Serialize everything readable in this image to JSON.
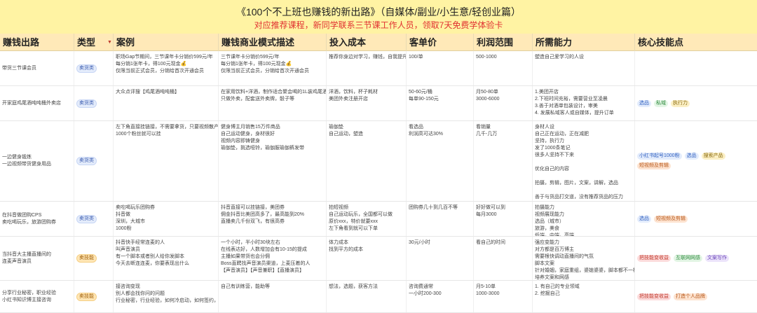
{
  "banner": {
    "title": "《100个不上班也赚钱的新出路》（自媒体/副业/小生意/轻创业篇）",
    "subtitle": "对应推荐课程，新同学联系三节课工作人员，领取7天免费学体验卡"
  },
  "columns": [
    "赚钱出路",
    "类型",
    "案例",
    "赚钱商业模式描述",
    "投入成本",
    "客单价",
    "利润范围",
    "所需能力",
    "核心技能点"
  ],
  "rows": [
    {
      "path": [
        "带货三节课会员"
      ],
      "type": "卖货类",
      "type_kind": "sell",
      "case": [
        "职场Gap节期间，三节课年卡分销价599元/年",
        "每分销1张年卡，得100元现金💰",
        "仅限当前正式会员，分销给首次开通会员"
      ],
      "model": [
        "三节课年卡分销价599元/年",
        "每分销1张年卡，得100元现金💰",
        "仅限当前正式会员，分销给首次开通会员"
      ],
      "cost": [
        "推荐你身边对学习，赚钱，自我提升关"
      ],
      "price": [
        "100/单"
      ],
      "profit": [
        "500-1000"
      ],
      "ability": [
        "塑造自己爱学习的人设"
      ],
      "skills": []
    },
    {
      "path": [
        "开家庭鸡尾酒吨吨桶外卖店"
      ],
      "type": "卖货类",
      "type_kind": "sell",
      "case": [
        "大众点评搜【鸡尾酒吨吨桶】"
      ],
      "model": [
        "在家用饮料+洋酒，制作适合聚会喝的1L装鸡尾酒",
        "只做外卖，配套送外卖牌，骰子等"
      ],
      "cost": [
        "洋酒，饮料，杯子耗材",
        "美团外卖注册开店"
      ],
      "price": [
        "50-60元/桶",
        "每单90-150元"
      ],
      "profit": [
        "月50-80单",
        "3000-6000"
      ],
      "ability": [
        "1.美团开店",
        "2.下班时间充裕，需要营业至凌晨",
        "3.善于对酒单包装设计，审美",
        "4. 发展私域客人或自媒体，提升订单"
      ],
      "skills": [
        {
          "label": "选品",
          "color": "blue"
        },
        {
          "label": "私域",
          "color": "green"
        },
        {
          "label": "执行力",
          "color": "yellow"
        }
      ]
    },
    {
      "path": [
        "一边健身锻炼",
        "一边视频带货健身用品"
      ],
      "type": "卖货类",
      "type_kind": "sell",
      "case": [
        "左下角直接挂链接，不需要拿货，只要视频散产品",
        "1000个粉丝就可以挂"
      ],
      "model": [
        "健身博主月销售15万件商品",
        "自己运动健身，身材很好",
        "视频内容即铸健身",
        "瑜伽垫，挑选哑铃，瑜伽服瑜伽裤发带"
      ],
      "cost": [
        "瑜伽垫",
        "自己运动，塑造"
      ],
      "price": [
        "看选品",
        "利润高可达30%"
      ],
      "profit": [
        "看销量",
        "几千-几万"
      ],
      "ability": [
        "身材人设",
        "自己正在运动，正在减肥",
        "坚持，执行力",
        "发了1000条笔记",
        "很多人坚持不下来",
        "",
        "优化自己的内容",
        "",
        "拍摄，剪辑，图片，文案，讲解，选品",
        "",
        "善于与货品打交道，没有推荐货品的压力"
      ],
      "skills": [
        {
          "label": "小红书起号1000粉",
          "color": "blue"
        },
        {
          "label": "选品",
          "color": "blue"
        },
        {
          "label": "搜索产品",
          "color": "yellow"
        },
        {
          "label": "短视频及剪辑",
          "color": "orange"
        }
      ]
    },
    {
      "path": [
        "在抖音做团购CPS",
        "卖吃喝玩乐，旅游团购券"
      ],
      "type": "卖货类",
      "type_kind": "sell",
      "case": [
        "卖吃喝玩乐团购券",
        "抖音做",
        "深圳，大城市",
        "1000粉"
      ],
      "model": [
        "抖音直接可以挂链接，美团券",
        "佣金抖音比美团高多了，最高能到20%",
        "直播卖几千份双飞，有很高券"
      ],
      "cost": [
        "拍短视频",
        "自己运动玩乐，全国都可以做",
        "原价xxx，特价就要xxx",
        "左下角看到就可以下单"
      ],
      "price": [
        "团购券几十到几百不等"
      ],
      "profit": [
        "好好做可以到",
        "每月3000"
      ],
      "ability": [
        "拍摄能力",
        "视频展现能力",
        "选品（城市）",
        "旅游，美食",
        "低端，中端，高端"
      ],
      "skills": [
        {
          "label": "选品",
          "color": "blue"
        },
        {
          "label": "短视频及剪辑",
          "color": "orange"
        }
      ]
    },
    {
      "path": [
        "当抖音大主播直播间的",
        "连麦声音演员"
      ],
      "type": "卖技能",
      "type_kind": "skill",
      "case": [
        "抖音快手经常连麦的人",
        "叫声音演员",
        "有一个脚本或者别人给你发脚本",
        "今天去断连连麦，你要表现出什么"
      ],
      "model": [
        "一个小时，半小时30块左右",
        "在线表达好，人数增加会有10-15的提成",
        "主播如果带货也会分佣",
        "Boss直聘找声音演员渠道，上麦压着的人",
        "【声音演员】【声音兼职】【直播演员】"
      ],
      "cost": [
        "体力成本",
        "找到平方的成本"
      ],
      "price": [
        "30元/小时"
      ],
      "profit": [
        "看自己的时间"
      ],
      "ability": [
        "强应变能力",
        "对方都是百万博主",
        "需要根快调动直播间的气氛",
        "脚本文案",
        "针对婚姻，家庭重组，婆媳婆婆，脚本都不一样",
        "培养文案和网感"
      ],
      "skills": [
        {
          "label": "把技能变收益",
          "color": "red"
        },
        {
          "label": "互联网网感",
          "color": "green"
        },
        {
          "label": "文案写作",
          "color": "purple"
        }
      ]
    },
    {
      "path": [
        "分享行业秘密，职业经验",
        "小红书知识博主接咨询"
      ],
      "type": "卖技能",
      "type_kind": "skill",
      "case": [
        "接咨询变现",
        "别人都会找你问的问题",
        "行业秘密，行业经验，如何冷启动，如何签约，职"
      ],
      "model": [
        "自己有训练营，能助等"
      ],
      "cost": [
        "想法，选题，获客方法"
      ],
      "price": [
        "咨询费通常",
        "一小时200-300"
      ],
      "profit": [
        "月5-10单",
        "1000-3000"
      ],
      "ability": [
        "1. 有自己的专业领域",
        "2. 挖掘自己"
      ],
      "skills": [
        {
          "label": "把技能变收益",
          "color": "red"
        },
        {
          "label": "打造个人品牌",
          "color": "orange"
        }
      ]
    }
  ]
}
